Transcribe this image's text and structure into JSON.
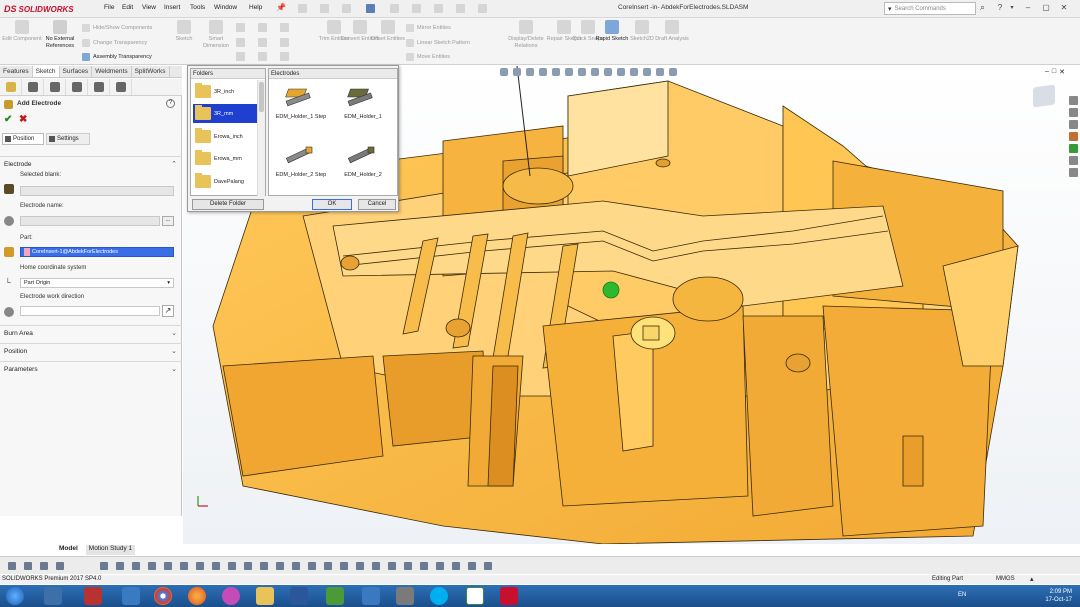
{
  "app": {
    "brand_ds": "DS",
    "brand_name": "SOLIDWORKS",
    "document_title": "CoreInsert -in- AbdekForElectrodes.SLDASM"
  },
  "menu": [
    "File",
    "Edit",
    "View",
    "Insert",
    "Tools",
    "Window",
    "Help"
  ],
  "search": {
    "placeholder": "Search Commands"
  },
  "commands": {
    "edit_component": "Edit Component",
    "no_external_refs": "No External References",
    "hide_show": "Hide/Show Components",
    "change_transparency": "Change Transparency",
    "assembly_transparency": "Assembly Transparency",
    "sketch": "Sketch",
    "smart_dimension": "Smart Dimension",
    "trim_entities": "Trim Entities",
    "convert_entities": "Convert Entities",
    "offset_entities": "Offset Entities",
    "mirror_entities": "Mirror Entities",
    "linear_pattern": "Linear Sketch Pattern",
    "move_entities": "Move Entities",
    "display_delete": "Display/Delete Relations",
    "repair_sketch": "Repair Sketch",
    "quick_snaps": "Quick Snaps",
    "rapid_sketch": "Rapid Sketch",
    "sketch2d": "Sketch2D",
    "draft_analysis": "Draft Analysis"
  },
  "tabs": [
    "Features",
    "Sketch",
    "Surfaces",
    "Weldments",
    "SplitWorks"
  ],
  "panel": {
    "title": "Add Electrode",
    "tab_position": "Position",
    "tab_settings": "Settings",
    "section_electrode": "Electrode",
    "selected_blank_label": "Selected blank:",
    "electrode_name_label": "Electrode name:",
    "part_label": "Part:",
    "part_value": "CoreInsert-1@AbdekForElectrodes",
    "home_coord_label": "Home coordinate system",
    "home_coord_value": "Part Origin",
    "work_direction_label": "Electrode work direction",
    "burn_area": "Burn Area",
    "position": "Position",
    "parameters": "Parameters"
  },
  "dialog": {
    "folders_header": "Folders",
    "electrodes_header": "Electrodes",
    "folders": [
      "3R_inch",
      "3R_mm",
      "Erowa_inch",
      "Erowa_mm",
      "DavePalang"
    ],
    "selected_folder": "3R_mm",
    "electrodes": [
      "EDM_Holder_1 Step",
      "EDM_Holder_1",
      "EDM_Holder_2 Step",
      "EDM_Holder_2"
    ],
    "delete_folder": "Delete Folder",
    "ok": "OK",
    "cancel": "Cancel"
  },
  "bottom_tabs": {
    "model": "Model",
    "motion": "Motion Study 1"
  },
  "status": {
    "left": "SOLIDWORKS Premium 2017 SP4.0",
    "editing": "Editing Part",
    "units": "MMGS"
  },
  "taskbar": {
    "lang": "EN",
    "time": "2:09 PM",
    "date": "17-Oct-17"
  },
  "colors": {
    "model": "#f5b942",
    "model_dark": "#c98e1e",
    "accent": "#1e3fcf",
    "taskbar": "#1b4f8c"
  }
}
